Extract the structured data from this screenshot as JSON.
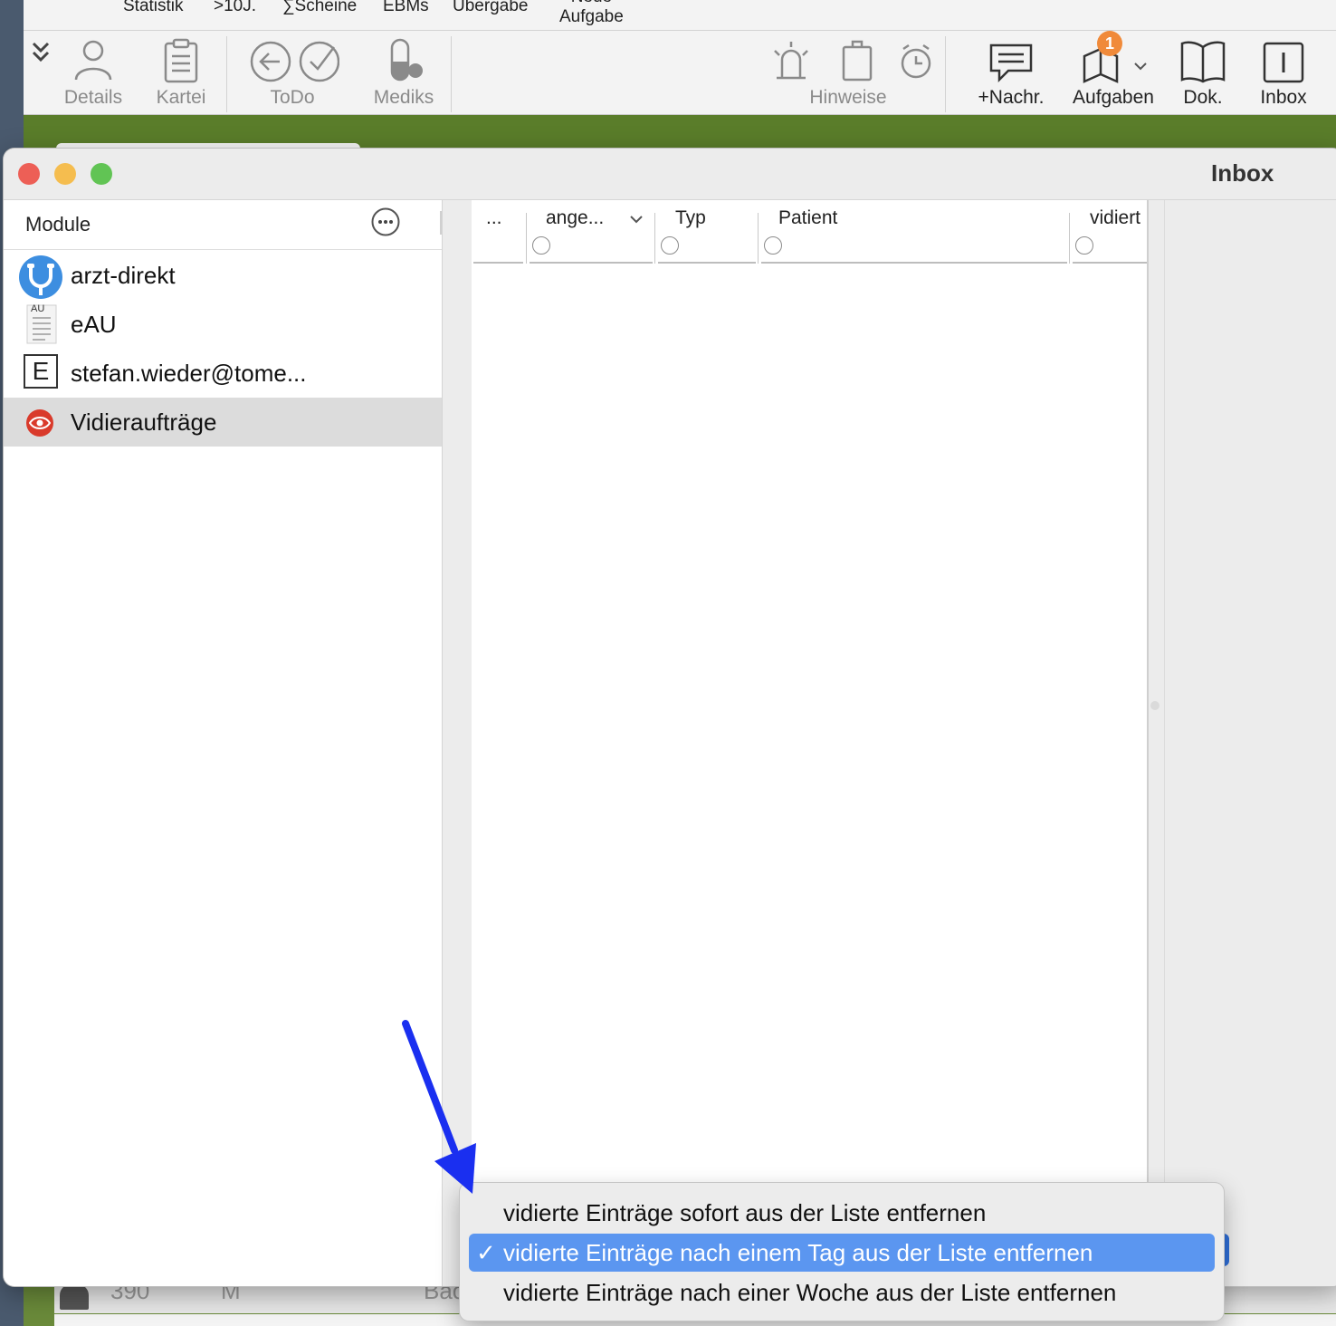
{
  "background_app": {
    "menu_labels": [
      "Statistik",
      ">10J.",
      "∑Scheine",
      "EBMs",
      "Übergabe",
      "Neue\nAufgabe"
    ],
    "toolbar": {
      "details": "Details",
      "kartei": "Kartei",
      "todo": "ToDo",
      "mediks": "Mediks",
      "hinweise": "Hinweise",
      "nachricht": "+Nachr.",
      "aufgaben": "Aufgaben",
      "aufgaben_badge": "1",
      "dok": "Dok.",
      "inbox": "Inbox"
    },
    "patient_row": {
      "number": "390",
      "sex": "M",
      "name_fragment": "Bac"
    }
  },
  "window": {
    "title": "Inbox",
    "colors": {
      "close": "#ed5f56",
      "minimize": "#f5bd4f",
      "zoom": "#61c454"
    }
  },
  "sidebar": {
    "title": "Module",
    "items": [
      {
        "label": "arzt-direkt",
        "icon": "stethoscope-icon",
        "selected": false
      },
      {
        "label": "eAU",
        "icon": "au-document-icon",
        "icon_text": "AU",
        "selected": false
      },
      {
        "label": "stefan.wieder@tome...",
        "icon": "letter-e-icon",
        "icon_text": "E",
        "selected": false
      },
      {
        "label": "Vidieraufträge",
        "icon": "eye-icon",
        "selected": true
      }
    ],
    "help_label": "?"
  },
  "table": {
    "columns": [
      {
        "label": "..."
      },
      {
        "label": "ange...",
        "sorted": "descending"
      },
      {
        "label": "Typ"
      },
      {
        "label": "Patient"
      },
      {
        "label": "vidiert"
      }
    ]
  },
  "popup_menu": {
    "items": [
      {
        "label": "vidierte Einträge sofort aus der Liste entfernen",
        "checked": false
      },
      {
        "label": "vidierte Einträge nach einem Tag aus der Liste entfernen",
        "checked": true
      },
      {
        "label": "vidierte Einträge nach einer Woche aus der Liste entfernen",
        "checked": false
      }
    ],
    "check_mark": "✓",
    "highlight_color": "#5b96f0"
  },
  "annotation": {
    "arrow_color": "#1a2ff0"
  }
}
